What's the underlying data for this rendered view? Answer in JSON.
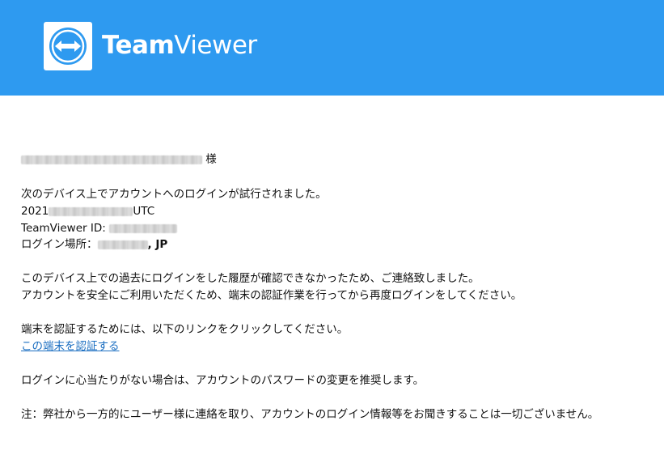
{
  "header": {
    "brand_bold": "Team",
    "brand_light": "Viewer",
    "bg_color": "#2e9af0"
  },
  "email": {
    "salutation_suffix": "様",
    "intro": "次のデバイス上でアカウントへのログインが試行されました。",
    "timestamp_prefix": "2021",
    "timestamp_suffix": "UTC",
    "tv_id_label": "TeamViewer ID:",
    "login_location_label": "ログイン場所：",
    "login_location_country": ", JP",
    "para1_line1": "このデバイス上での過去にログインをした履歴が確認できなかったため、ご連絡致しました。",
    "para1_line2": "アカウントを安全にご利用いただくため、端末の認証作業を行ってから再度ログインをしてください。",
    "para2_line1": "端末を認証するためには、以下のリンクをクリックしてください。",
    "verify_link": "この端末を認証する",
    "para3": "ログインに心当たりがない場合は、アカウントのパスワードの変更を推奨します。",
    "note": "注：弊社から一方的にユーザー様に連絡を取り、アカウントのログイン情報等をお聞きすることは一切ございません。"
  },
  "colors": {
    "link": "#1a6ec1",
    "text": "#111111"
  }
}
